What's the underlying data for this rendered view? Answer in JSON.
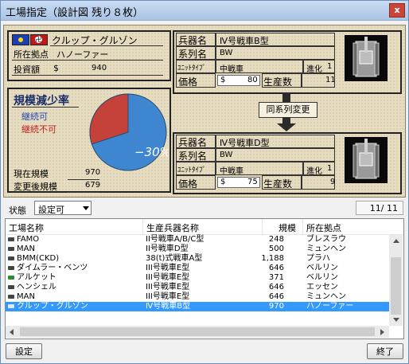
{
  "window": {
    "title": "工場指定（設計図 残り８枚）",
    "close_label": "x"
  },
  "company": {
    "name": "クルップ・グルゾン",
    "location_label": "所在拠点",
    "location": "ハノーファー",
    "investment_label": "投資額",
    "investment_currency": "$",
    "investment_value": "940"
  },
  "scale": {
    "title": "規模減少率",
    "continue_ok": "継続可",
    "continue_ng": "継続不可",
    "percent": "−30%",
    "reduction_fraction": 0.3,
    "current_label": "現在規模",
    "current_value": "970",
    "after_label": "変更後規模",
    "after_value": "679"
  },
  "weapon_top": {
    "name_label": "兵器名",
    "name": "Ⅳ号戦車B型",
    "series_label": "系列名",
    "series": "BW",
    "unit_label": "ﾕﾆｯﾄﾀｲﾌﾟ",
    "unit": "中戦車",
    "evo_label": "進化",
    "evo": "1",
    "price_label": "価格",
    "price_currency": "$",
    "price": "80",
    "production_label": "生産数",
    "production": "11"
  },
  "change_button": "同系列変更",
  "weapon_bottom": {
    "name_label": "兵器名",
    "name": "Ⅳ号戦車D型",
    "series_label": "系列名",
    "series": "BW",
    "unit_label": "ﾕﾆｯﾄﾀｲﾌﾟ",
    "unit": "中戦車",
    "evo_label": "進化",
    "evo": "1",
    "price_label": "価格",
    "price_currency": "$",
    "price": "75",
    "production_label": "生産数",
    "production": "9"
  },
  "status": {
    "label": "状態",
    "value": "設定可",
    "page": "11/ 11"
  },
  "table": {
    "headers": [
      "工場名称",
      "生産兵器名称",
      "規模",
      "所在拠点"
    ],
    "rows": [
      {
        "factory": "FAMO",
        "weapon": "II号戦車A/B/C型",
        "scale": "248",
        "location": "ブレスラウ"
      },
      {
        "factory": "MAN",
        "weapon": "II号戦車D型",
        "scale": "500",
        "location": "ミュンヘン"
      },
      {
        "factory": "BMM(CKD)",
        "weapon": "38(t)式戦車A型",
        "scale": "1,188",
        "location": "プラハ"
      },
      {
        "factory": "ダイムラー・ベンツ",
        "weapon": "III号戦車E型",
        "scale": "646",
        "location": "ベルリン"
      },
      {
        "factory": "アルケット",
        "weapon": "III号戦車E型",
        "scale": "371",
        "location": "ベルリン"
      },
      {
        "factory": "ヘンシェル",
        "weapon": "III号戦車E型",
        "scale": "646",
        "location": "エッセン"
      },
      {
        "factory": "MAN",
        "weapon": "III号戦車E型",
        "scale": "646",
        "location": "ミュンヘン"
      },
      {
        "factory": "クルップ・グルゾン",
        "weapon": "Ⅳ号戦車B型",
        "scale": "970",
        "location": "ハノーファー"
      }
    ]
  },
  "buttons": {
    "settings": "設定",
    "exit": "終了"
  },
  "colors": {
    "pie_blue": "#3f86d0",
    "pie_red": "#c5423a",
    "selection": "#3399ff",
    "panel": "#e6dcc0"
  }
}
